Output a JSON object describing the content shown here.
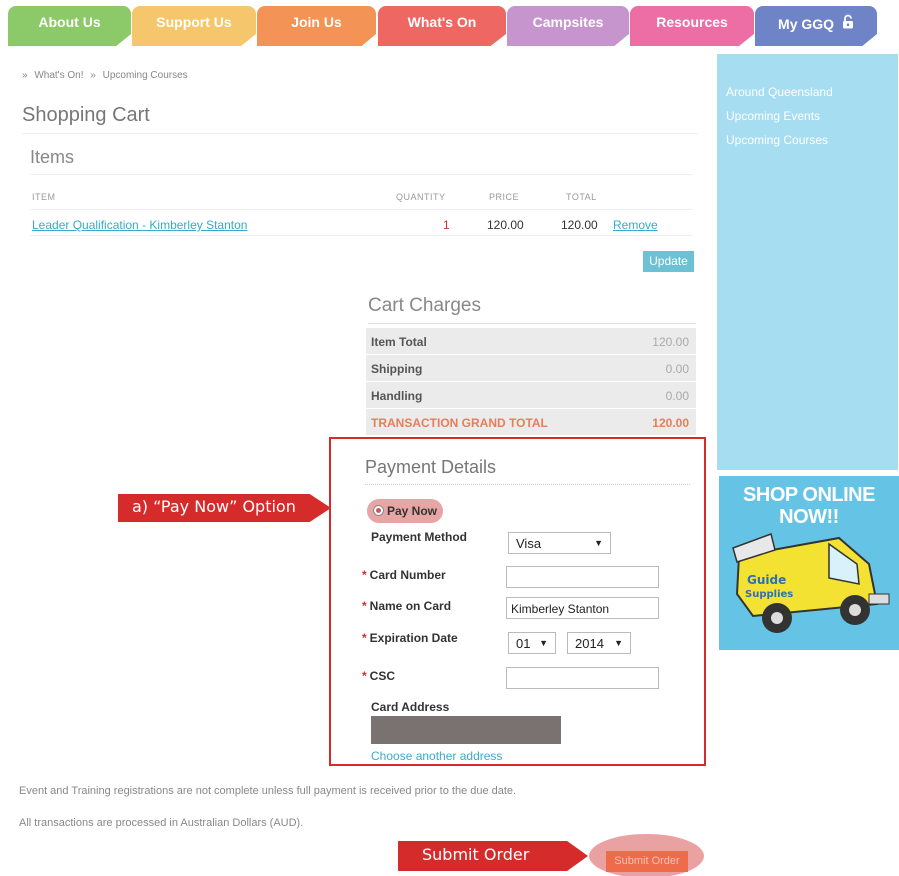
{
  "nav": {
    "tabs": [
      {
        "label": "About Us",
        "color": "#8cc968"
      },
      {
        "label": "Support Us",
        "color": "#f6c66d"
      },
      {
        "label": "Join Us",
        "color": "#f39355"
      },
      {
        "label": "What's On",
        "color": "#ef6763"
      },
      {
        "label": "Campsites",
        "color": "#c795cd"
      },
      {
        "label": "Resources",
        "color": "#ec6ea5"
      },
      {
        "label": "My GGQ",
        "color": "#6f84c6",
        "icon": "lock-icon"
      }
    ]
  },
  "breadcrumb": {
    "items": [
      "What's On!",
      "Upcoming Courses"
    ],
    "separator": "»"
  },
  "cart": {
    "title": "Shopping Cart",
    "items_title": "Items",
    "columns": {
      "item": "ITEM",
      "quantity": "QUANTITY",
      "price": "PRICE",
      "total": "TOTAL"
    },
    "rows": [
      {
        "item": "Leader Qualification - Kimberley Stanton",
        "quantity": "1",
        "price": "120.00",
        "total": "120.00",
        "remove": "Remove"
      }
    ],
    "update_label": "Update"
  },
  "charges": {
    "title": "Cart Charges",
    "rows": [
      {
        "label": "Item Total",
        "value": "120.00"
      },
      {
        "label": "Shipping",
        "value": "0.00"
      },
      {
        "label": "Handling",
        "value": "0.00"
      },
      {
        "label": "TRANSACTION GRAND TOTAL",
        "value": "120.00"
      }
    ]
  },
  "payment": {
    "title": "Payment Details",
    "pay_now_label": "Pay Now",
    "method_label": "Payment Method",
    "method_value": "Visa",
    "card_number_label": "Card Number",
    "card_number_value": "",
    "name_label": "Name on Card",
    "name_value": "Kimberley Stanton",
    "expiry_label": "Expiration Date",
    "expiry_month": "01",
    "expiry_year": "2014",
    "csc_label": "CSC",
    "csc_value": "",
    "address_label": "Card Address",
    "choose_address": "Choose another address",
    "required_marker": "*"
  },
  "annotations": {
    "pay_now": "a) “Pay Now” Option",
    "submit": "Submit Order"
  },
  "notes": {
    "line1": "Event and Training registrations are not complete unless full payment is received prior to the due date.",
    "line2": "All transactions are processed in Australian Dollars (AUD)."
  },
  "submit": {
    "label": "Submit Order"
  },
  "sidebar": {
    "links": [
      "Around Queensland",
      "Upcoming Events",
      "Upcoming Courses"
    ]
  },
  "promo": {
    "headline_line1": "SHOP ONLINE",
    "headline_line2": "NOW!!",
    "van_text_line1": "Guide",
    "van_text_line2": "Supplies"
  }
}
